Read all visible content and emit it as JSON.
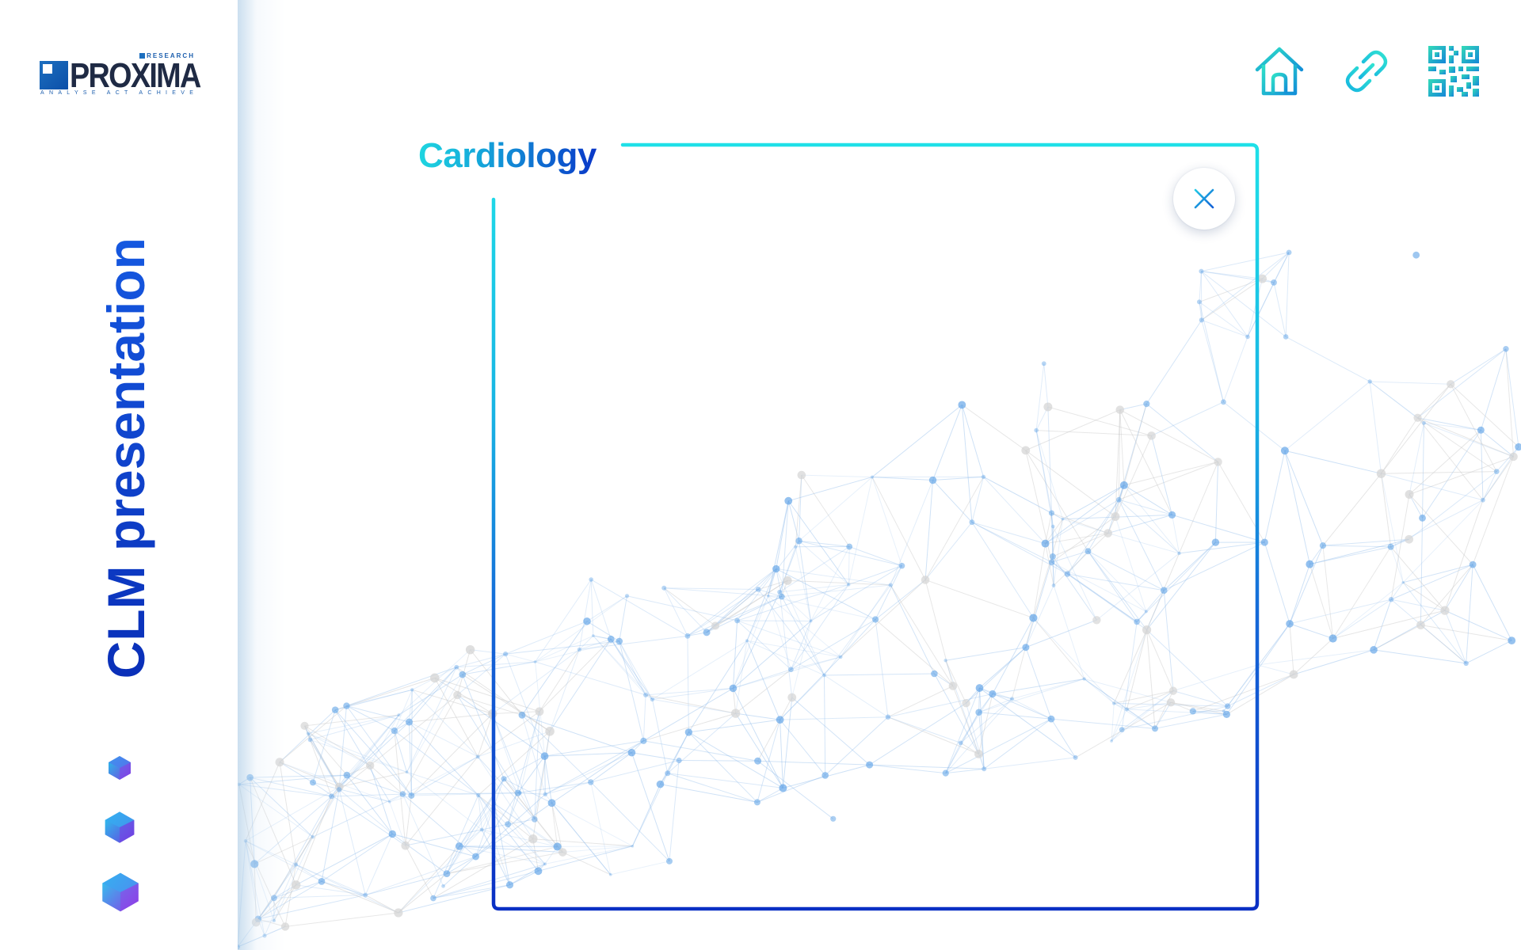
{
  "sidebar": {
    "logo": {
      "name": "PROXIMA",
      "superscript": "RESEARCH",
      "tagline": "ANALYSE   ACT   ACHIEVE"
    },
    "title": "CLM presentation",
    "title_colors": [
      "#0a2fb8",
      "#1558e0"
    ],
    "decorations": [
      "cube-small",
      "cube-medium",
      "cube-large"
    ]
  },
  "toolbar": {
    "home_icon": "home-icon",
    "link_icon": "link-icon",
    "qr_icon": "qr-code-icon"
  },
  "panel": {
    "title": "Cardiology",
    "close_icon": "close-icon",
    "frame_gradient": [
      "#1fe0e8",
      "#0a2fc4"
    ]
  },
  "colors": {
    "accent_cyan": "#1fd6e0",
    "accent_blue": "#0b2fc4",
    "network_blue": "#5aa0e6"
  }
}
